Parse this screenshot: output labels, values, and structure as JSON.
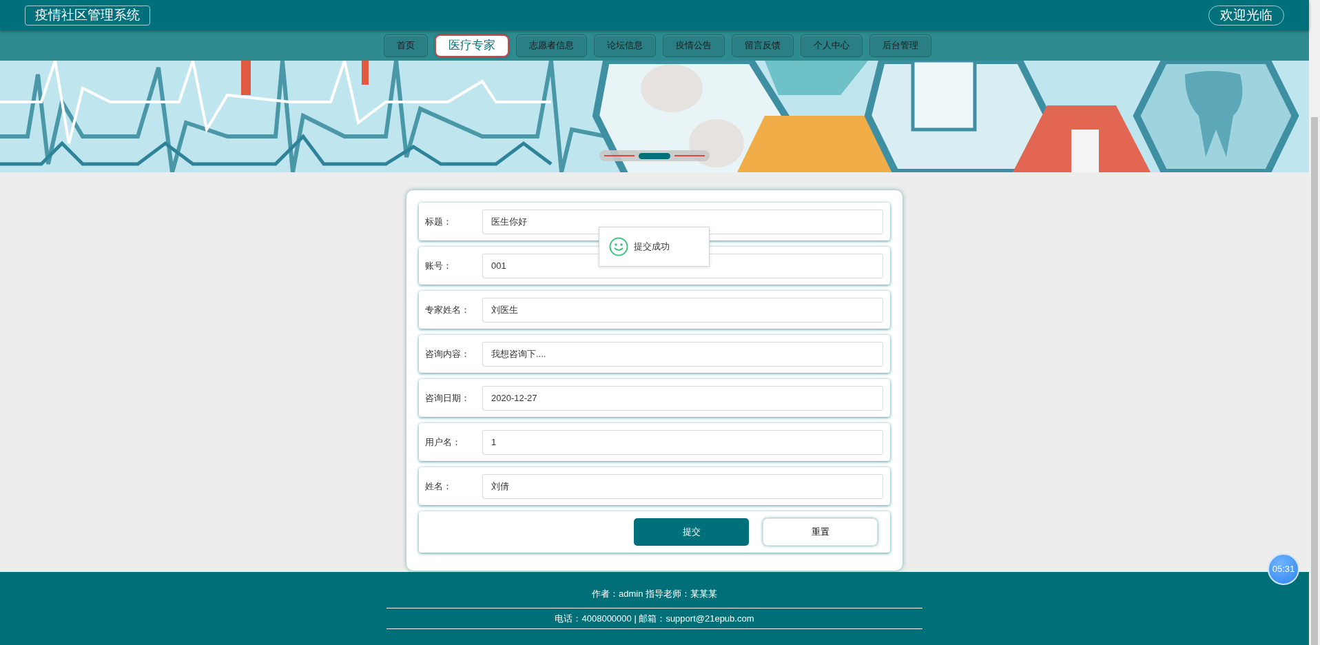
{
  "header": {
    "title": "疫情社区管理系统",
    "welcome": "欢迎光临"
  },
  "nav": [
    {
      "label": "首页",
      "selected": false
    },
    {
      "label": "医疗专家",
      "selected": true
    },
    {
      "label": "志愿者信息",
      "selected": false
    },
    {
      "label": "论坛信息",
      "selected": false
    },
    {
      "label": "疫情公告",
      "selected": false
    },
    {
      "label": "留言反馈",
      "selected": false
    },
    {
      "label": "个人中心",
      "selected": false
    },
    {
      "label": "后台管理",
      "selected": false
    }
  ],
  "banner": {
    "slides": [
      {
        "selected": false
      },
      {
        "selected": true
      },
      {
        "selected": false
      }
    ]
  },
  "form": {
    "fields": [
      {
        "label": "标题：",
        "value": "医生你好"
      },
      {
        "label": "账号：",
        "value": "001"
      },
      {
        "label": "专家姓名：",
        "value": "刘医生"
      },
      {
        "label": "咨询内容：",
        "value": "我想咨询下...."
      },
      {
        "label": "咨询日期：",
        "value": "2020-12-27"
      },
      {
        "label": "用户名：",
        "value": "1"
      },
      {
        "label": "姓名：",
        "value": "刘倩"
      }
    ],
    "buttons": [
      {
        "label": "提交",
        "kind": "primary"
      },
      {
        "label": "重置",
        "kind": "secondary"
      }
    ]
  },
  "toast": {
    "message": "提交成功"
  },
  "footer": {
    "lines": [
      "作者：admin 指导老师：某某某",
      "电话：4008000000 | 邮箱：support@21epub.com"
    ]
  },
  "timer": "05:31"
}
